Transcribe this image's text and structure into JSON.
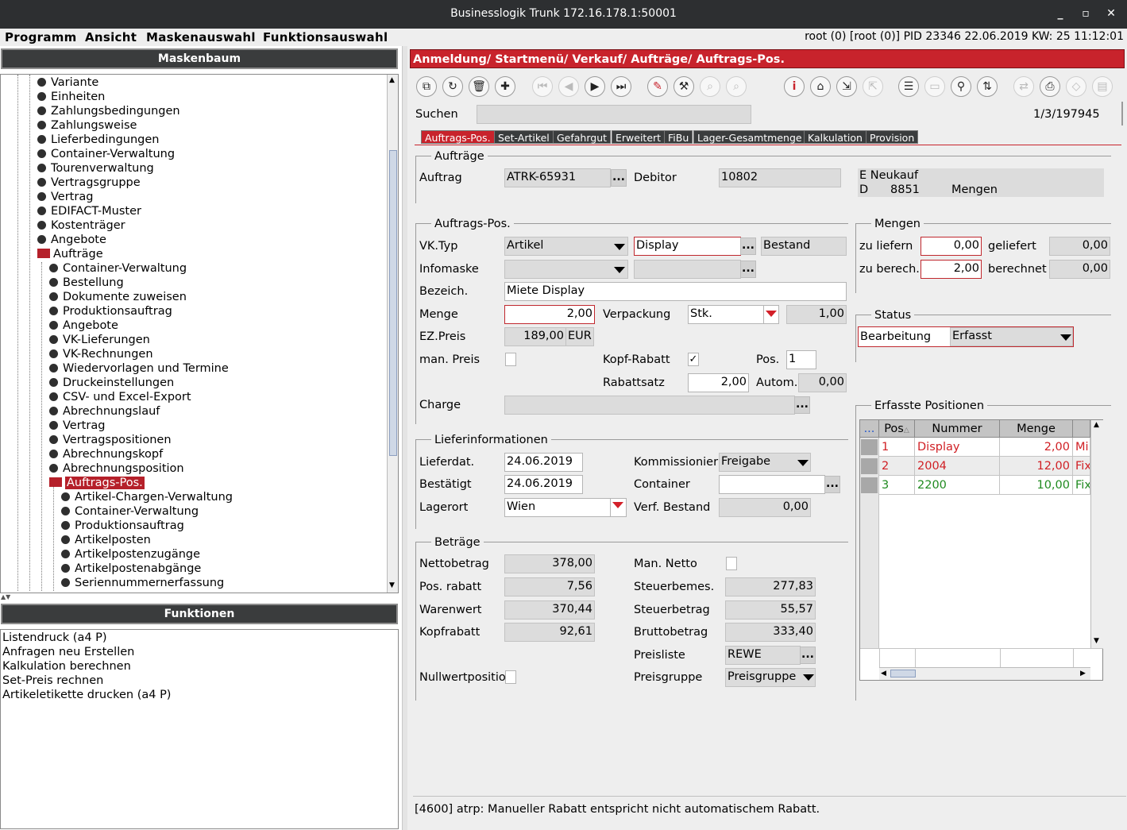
{
  "window": {
    "title": "Businesslogik Trunk 172.16.178.1:50001",
    "minimize": "_",
    "maximize": "▫",
    "close": "✕"
  },
  "menu": {
    "items": [
      "Programm",
      "Ansicht",
      "Maskenauswahl",
      "Funktionsauswahl"
    ],
    "status": "root (0) [root (0)] PID 23346  22.06.2019 KW: 25  11:12:01"
  },
  "left": {
    "tree_title": "Maskenbaum",
    "functions_title": "Funktionen",
    "tree": [
      {
        "label": "Variante",
        "level": 2
      },
      {
        "label": "Einheiten",
        "level": 2
      },
      {
        "label": "Zahlungsbedingungen",
        "level": 2
      },
      {
        "label": "Zahlungsweise",
        "level": 2
      },
      {
        "label": "Lieferbedingungen",
        "level": 2
      },
      {
        "label": "Container-Verwaltung",
        "level": 2
      },
      {
        "label": "Tourenverwaltung",
        "level": 2
      },
      {
        "label": "Vertragsgruppe",
        "level": 2
      },
      {
        "label": "Vertrag",
        "level": 2
      },
      {
        "label": "EDIFACT-Muster",
        "level": 2
      },
      {
        "label": "Kostenträger",
        "level": 2
      },
      {
        "label": "Angebote",
        "level": 2
      },
      {
        "label": "Aufträge",
        "level": 2,
        "folder": true
      },
      {
        "label": "Container-Verwaltung",
        "level": 3
      },
      {
        "label": "Bestellung",
        "level": 3
      },
      {
        "label": "Dokumente zuweisen",
        "level": 3
      },
      {
        "label": "Produktionsauftrag",
        "level": 3
      },
      {
        "label": "Angebote",
        "level": 3
      },
      {
        "label": "VK-Lieferungen",
        "level": 3
      },
      {
        "label": "VK-Rechnungen",
        "level": 3
      },
      {
        "label": "Wiedervorlagen und Termine",
        "level": 3
      },
      {
        "label": "Druckeinstellungen",
        "level": 3
      },
      {
        "label": "CSV- und Excel-Export",
        "level": 3
      },
      {
        "label": "Abrechnungslauf",
        "level": 3
      },
      {
        "label": "Vertrag",
        "level": 3
      },
      {
        "label": "Vertragspositionen",
        "level": 3
      },
      {
        "label": "Abrechnungskopf",
        "level": 3
      },
      {
        "label": "Abrechnungsposition",
        "level": 3
      },
      {
        "label": "Auftrags-Pos.",
        "level": 3,
        "folder": true,
        "selected": true
      },
      {
        "label": "Artikel-Chargen-Verwaltung",
        "level": 4
      },
      {
        "label": "Container-Verwaltung",
        "level": 4
      },
      {
        "label": "Produktionsauftrag",
        "level": 4
      },
      {
        "label": "Artikelposten",
        "level": 4
      },
      {
        "label": "Artikelpostenzugänge",
        "level": 4
      },
      {
        "label": "Artikelpostenabgänge",
        "level": 4
      },
      {
        "label": "Seriennummernerfassung",
        "level": 4
      }
    ],
    "functions": [
      "Listendruck (a4 P)",
      "Anfragen neu Erstellen",
      "Kalkulation berechnen",
      "Set-Preis rechnen",
      "Artikeletikette drucken (a4 P)"
    ]
  },
  "breadcrumb": "Anmeldung/ Startmenü/ Verkauf/ Aufträge/ Auftrags-Pos.",
  "toolbar": [
    {
      "name": "copy",
      "glyph": "⧉"
    },
    {
      "name": "refresh",
      "glyph": "↻"
    },
    {
      "name": "delete",
      "glyph": "🗑"
    },
    {
      "name": "add",
      "glyph": "✚"
    },
    {
      "name": "first",
      "glyph": "⏮",
      "disabled": true
    },
    {
      "name": "prev",
      "glyph": "◀",
      "disabled": true
    },
    {
      "name": "next",
      "glyph": "▶"
    },
    {
      "name": "last",
      "glyph": "⏭"
    },
    {
      "name": "edit",
      "glyph": "✎"
    },
    {
      "name": "tool",
      "glyph": "⚒"
    },
    {
      "name": "find-a",
      "glyph": "⌕",
      "disabled": true
    },
    {
      "name": "find-b",
      "glyph": "⌕",
      "disabled": true
    },
    {
      "name": "info",
      "glyph": "i"
    },
    {
      "name": "home",
      "glyph": "⌂"
    },
    {
      "name": "import",
      "glyph": "⇲"
    },
    {
      "name": "export",
      "glyph": "⇱",
      "disabled": true
    },
    {
      "name": "list",
      "glyph": "☰"
    },
    {
      "name": "window",
      "glyph": "▭",
      "disabled": true
    },
    {
      "name": "search",
      "glyph": "⚲"
    },
    {
      "name": "sort",
      "glyph": "⇅"
    },
    {
      "name": "swap",
      "glyph": "⇄",
      "disabled": true
    },
    {
      "name": "print",
      "glyph": "⎙"
    },
    {
      "name": "tag",
      "glyph": "◇",
      "disabled": true
    },
    {
      "name": "doc",
      "glyph": "▤",
      "disabled": true
    }
  ],
  "search": {
    "label": "Suchen",
    "value": "",
    "counter": "1/3/197945"
  },
  "tabs": [
    "Auftrags-Pos.",
    "Set-Artikel",
    "Gefahrgut",
    "Erweitert",
    "FiBu",
    "Lager-Gesamtmenge",
    "Kalkulation",
    "Provision"
  ],
  "auftraege": {
    "title": "Aufträge",
    "auftrag_label": "Auftrag",
    "auftrag": "ATRK-65931",
    "debitor_label": "Debitor",
    "debitor": "10802",
    "name_line1": "E Neukauf",
    "name_line2a": "D",
    "name_line2b": "8851",
    "name_line2c": "Mengen"
  },
  "pos": {
    "title": "Auftrags-Pos.",
    "vktyp_label": "VK.Typ",
    "vktyp": "Artikel",
    "artikel": "Display",
    "bestand": "Bestand",
    "infomaske_label": "Infomaske",
    "infomaske": "",
    "infomaske2": "",
    "bezeich_label": "Bezeich.",
    "bezeich": "Miete Display",
    "menge_label": "Menge",
    "menge": "2,00",
    "verpackung_label": "Verpackung",
    "verpackung": "Stk.",
    "verpackung_qty": "1,00",
    "ezpreis_label": "EZ.Preis",
    "ezpreis": "189,00",
    "currency": "EUR",
    "manpreis_label": "man. Preis",
    "kopfrabatt_label": "Kopf-Rabatt",
    "kopfrabatt_checked": "✓",
    "pos_label": "Pos.",
    "pos": "1",
    "rabattsatz_label": "Rabattsatz",
    "rabattsatz": "2,00",
    "autom_label": "Autom.",
    "autom": "0,00",
    "charge_label": "Charge",
    "charge": ""
  },
  "mengen": {
    "title": "Mengen",
    "zuliefern_label": "zu liefern",
    "zuliefern": "0,00",
    "geliefert_label": "geliefert",
    "geliefert": "0,00",
    "zuberech_label": "zu berech.",
    "zuberech": "2,00",
    "berechnet_label": "berechnet",
    "berechnet": "0,00"
  },
  "status": {
    "title": "Status",
    "label": "Bearbeitung",
    "value": "Erfasst"
  },
  "liefer": {
    "title": "Lieferinformationen",
    "lieferdat_label": "Lieferdat.",
    "lieferdat": "24.06.2019",
    "kommission_label": "Kommissionier",
    "kommission": "Freigabe",
    "bestaetigt_label": "Bestätigt",
    "bestaetigt": "24.06.2019",
    "container_label": "Container",
    "container": "",
    "lagerort_label": "Lagerort",
    "lagerort": "Wien",
    "verfbestand_label": "Verf. Bestand",
    "verfbestand": "0,00"
  },
  "betraege": {
    "title": "Beträge",
    "netto_label": "Nettobetrag",
    "netto": "378,00",
    "manNetto_label": "Man. Netto",
    "posrabatt_label": "Pos. rabatt",
    "posrabatt": "7,56",
    "steuerbemes_label": "Steuerbemes.",
    "steuerbemes": "277,83",
    "warenwert_label": "Warenwert",
    "warenwert": "370,44",
    "steuerbetrag_label": "Steuerbetrag",
    "steuerbetrag": "55,57",
    "kopfrabatt_label": "Kopfrabatt",
    "kopfrabatt": "92,61",
    "brutto_label": "Bruttobetrag",
    "brutto": "333,40",
    "preisliste_label": "Preisliste",
    "preisliste": "REWE",
    "nullwert_label": "Nullwertpositio",
    "preisgruppe_label": "Preisgruppe",
    "preisgruppe": "Preisgruppe"
  },
  "positions": {
    "title": "Erfasste Positionen",
    "header_dots": "...",
    "col_pos": "Pos",
    "col_nummer": "Nummer",
    "col_menge": "Menge",
    "rows": [
      {
        "pos": "1",
        "nummer": "Display",
        "menge": "2,00",
        "extra": "Mi",
        "color": "#d01f24"
      },
      {
        "pos": "2",
        "nummer": "2004",
        "menge": "12,00",
        "extra": "Fix",
        "color": "#d01f24"
      },
      {
        "pos": "3",
        "nummer": "2200",
        "menge": "10,00",
        "extra": "Fix",
        "color": "#1f8a1f"
      }
    ]
  },
  "statusline": "[4600] atrp: Manueller Rabatt entspricht nicht automatischem Rabatt."
}
